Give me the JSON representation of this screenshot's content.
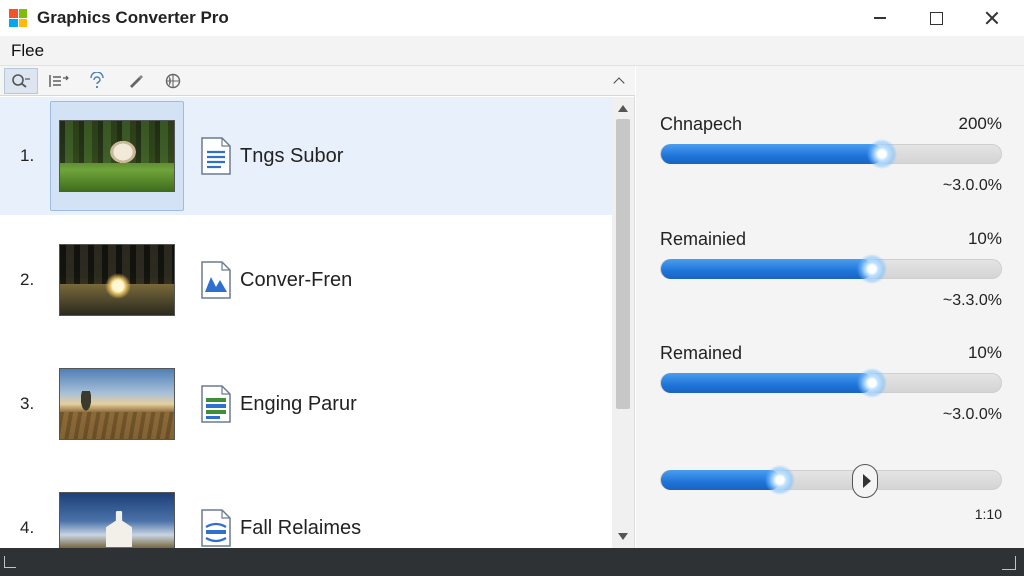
{
  "window": {
    "title": "Graphics Converter Pro",
    "icon": "windows-logo-icon",
    "controls": [
      "minimize-icon",
      "maximize-icon",
      "close-icon"
    ]
  },
  "menu": {
    "items": [
      {
        "label": "Flee"
      }
    ]
  },
  "toolbar": {
    "tools": [
      {
        "name": "search-zoom-icon",
        "glyph": "🔍",
        "active": true
      },
      {
        "name": "list-view-icon",
        "glyph": "☰"
      },
      {
        "name": "help-icon",
        "glyph": "?"
      },
      {
        "name": "brush-icon",
        "glyph": "✎"
      },
      {
        "name": "globe-icon",
        "glyph": "◍"
      }
    ]
  },
  "files": [
    {
      "num": "1.",
      "name": "Tngs Subor",
      "icon": "document-icon",
      "selected": true
    },
    {
      "num": "2.",
      "name": "Conver-Fren",
      "icon": "image-file-icon",
      "selected": false
    },
    {
      "num": "3.",
      "name": "Enging Parur",
      "icon": "spreadsheet-icon",
      "selected": false
    },
    {
      "num": "4.",
      "name": "Fall Relaimes",
      "icon": "presentation-icon",
      "selected": false
    }
  ],
  "sliders": [
    {
      "label": "Chnapech",
      "value_text": "200%",
      "sub_text": "~3.0.0%",
      "level": 0.65
    },
    {
      "label": "Remainied",
      "value_text": "10%",
      "sub_text": "~3.3.0%",
      "level": 0.62
    },
    {
      "label": "Remained",
      "value_text": "10%",
      "sub_text": "~3.0.0%",
      "level": 0.62
    }
  ],
  "playback": {
    "level": 0.35,
    "position": 0.6,
    "time_text": "1:10"
  },
  "colors": {
    "accent": "#1f74d8",
    "status_bar": "#2f3235",
    "selection": "#e8f0fb"
  }
}
